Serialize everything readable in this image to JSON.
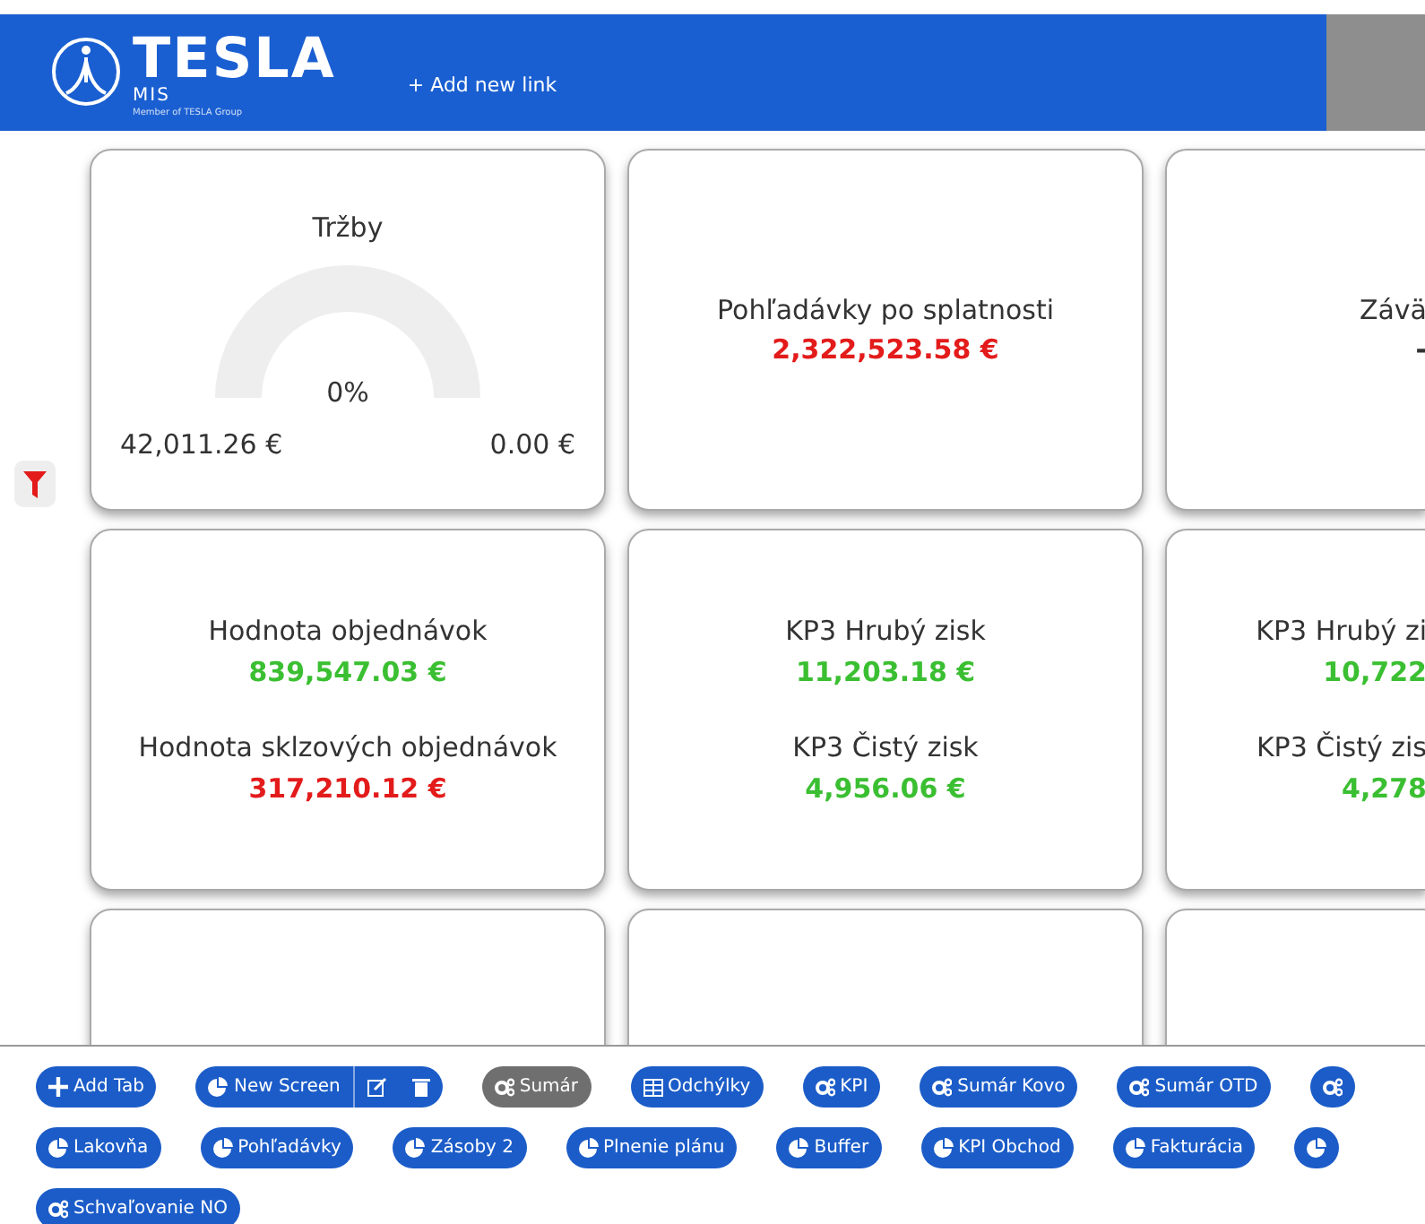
{
  "header": {
    "brand": "TESLA",
    "subbrand": "MIS",
    "tagline": "Member of TESLA Group",
    "add_link": "+ Add new link"
  },
  "card_rows": [
    {
      "cards": [
        {
          "kind": "gauge",
          "title": "Tržby",
          "percent": "0%",
          "min": "42,011.26 €",
          "max": "0.00 €"
        },
        {
          "kind": "metrics",
          "metrics": [
            {
              "label": "Pohľadávky po splatnosti",
              "value": "2,322,523.58 €",
              "color": "#e31b1b"
            }
          ]
        },
        {
          "kind": "cut",
          "metrics": [
            {
              "label": "Závä",
              "value": "-",
              "color": "#333333"
            }
          ]
        }
      ]
    },
    {
      "cards": [
        {
          "kind": "metrics",
          "metrics": [
            {
              "label": "Hodnota objednávok",
              "value": "839,547.03 €",
              "color": "#3bbf32"
            },
            {
              "label": "Hodnota sklzových objednávok",
              "value": "317,210.12 €",
              "color": "#e31b1b"
            }
          ]
        },
        {
          "kind": "metrics",
          "metrics": [
            {
              "label": "KP3 Hrubý zisk",
              "value": "11,203.18 €",
              "color": "#3bbf32"
            },
            {
              "label": "KP3 Čistý zisk",
              "value": "4,956.06 €",
              "color": "#3bbf32"
            }
          ]
        },
        {
          "kind": "cut",
          "metrics": [
            {
              "label": "KP3 Hrubý zi",
              "value": "10,722",
              "color": "#3bbf32"
            },
            {
              "label": "KP3 Čistý zis",
              "value": "4,278",
              "color": "#3bbf32"
            }
          ]
        }
      ]
    },
    {
      "cards": [
        {
          "kind": "empty"
        },
        {
          "kind": "empty"
        },
        {
          "kind": "empty"
        }
      ]
    }
  ],
  "tab_rows": [
    [
      {
        "kind": "add",
        "label": "Add Tab"
      },
      {
        "kind": "screen",
        "label": "New Screen",
        "selected": false
      },
      {
        "kind": "gears",
        "label": "Sumár",
        "selected": true
      },
      {
        "kind": "table",
        "label": "Odchýlky",
        "selected": false
      },
      {
        "kind": "gears",
        "label": "KPI",
        "selected": false
      },
      {
        "kind": "gears",
        "label": "Sumár Kovo",
        "selected": false
      },
      {
        "kind": "gears",
        "label": "Sumár OTD",
        "selected": false
      },
      {
        "kind": "gears",
        "selected": false
      }
    ],
    [
      {
        "kind": "pie",
        "label": "Lakovňa",
        "selected": false
      },
      {
        "kind": "pie",
        "label": "Pohľadávky",
        "selected": false
      },
      {
        "kind": "pie",
        "label": "Zásoby 2",
        "selected": false
      },
      {
        "kind": "pie",
        "label": "Plnenie plánu",
        "selected": false
      },
      {
        "kind": "pie",
        "label": "Buffer",
        "selected": false
      },
      {
        "kind": "pie",
        "label": "KPI Obchod",
        "selected": false
      },
      {
        "kind": "pie",
        "label": "Fakturácia",
        "selected": false
      },
      {
        "kind": "pie",
        "selected": false
      }
    ],
    [
      {
        "kind": "gears",
        "label": "Schvaľovanie NO",
        "selected": false
      }
    ]
  ]
}
